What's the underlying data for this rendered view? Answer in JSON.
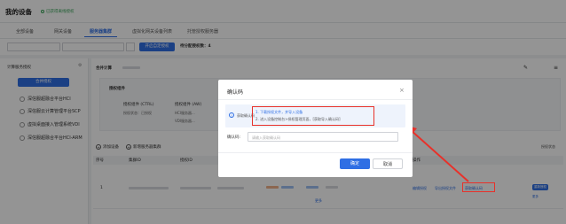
{
  "header": {
    "title": "我的设备",
    "status_text": "已获得离线授权"
  },
  "tabs": [
    {
      "label": "全部设备"
    },
    {
      "label": "网关设备"
    },
    {
      "label": "服务器集群"
    },
    {
      "label": "虚拟化网关设备列表"
    },
    {
      "label": "托管授权服务器"
    }
  ],
  "toolbar": {
    "primary_button": "开启自定授权",
    "pending_label": "待分配授权数：",
    "pending_count": "4"
  },
  "sidebar": {
    "filter_label": "计算服务授权",
    "merge_button": "合并授权",
    "items": [
      {
        "label": "深信服超融合平台HCI"
      },
      {
        "label": "深信服云计算管理平台SCP"
      },
      {
        "label": "虚拟桌面接入管理系统VDI"
      },
      {
        "label": "深信服超融合平台HCI-ARM"
      }
    ]
  },
  "main": {
    "summary_label": "合并计算",
    "section_label": "授权组件",
    "comp1_title": "授权组件 (CTRL)",
    "comp1_status": "授权状态：已授权",
    "comp2_title": "授权组件 (AW)",
    "comp2_line1": "HCI服务器...",
    "comp2_line2": "VDI服务器...",
    "add_device": "添加设备",
    "add_cluster": "新增服务器集群",
    "col_index": "序号",
    "col_name": "集群ID",
    "col_serial": "授权ID",
    "col_ops": "操作",
    "col_right": "授权状态",
    "row_index": "1",
    "op_edit": "编辑授权",
    "op_export": "导出授权文件",
    "op_confirm": "获取确认码",
    "row_more": "更多",
    "right_btn": "重新授权",
    "right_more": "更多"
  },
  "modal": {
    "title": "确认码",
    "info_lead": "获取确认码",
    "step1": "1. 下载授权文件，并导入设备",
    "step2": "2. 进入设备控制台>授权管理页面，[获取导入确认码]",
    "input_label": "确认码:",
    "input_placeholder": "请输入获取确认码",
    "confirm": "确定",
    "cancel": "取消"
  },
  "colors": {
    "accent": "#2f6fe4",
    "highlight": "#e8312a"
  }
}
